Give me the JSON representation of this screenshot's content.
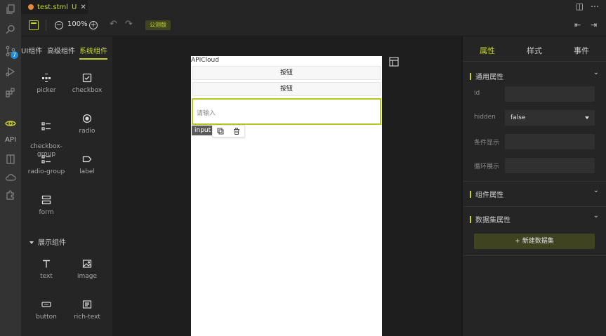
{
  "tab": {
    "filename": "test.stml",
    "status": "U"
  },
  "toolbar": {
    "zoom": "100%",
    "badge": "公测版"
  },
  "left_panel": {
    "tabs": [
      "UI组件",
      "高级组件",
      "系统组件"
    ],
    "components": [
      {
        "label": "picker",
        "icon": "picker-icon"
      },
      {
        "label": "checkbox",
        "icon": "checkbox-icon"
      },
      {
        "label": "checkbox-\ngroup",
        "icon": "list-icon"
      },
      {
        "label": "radio",
        "icon": "radio-icon"
      },
      {
        "label": "radio-group",
        "icon": "list-icon"
      },
      {
        "label": "label",
        "icon": "label-icon"
      },
      {
        "label": "form",
        "icon": "form-icon"
      }
    ],
    "section": "展示组件",
    "display_components": [
      {
        "label": "text",
        "icon": "text-icon"
      },
      {
        "label": "image",
        "icon": "image-icon"
      },
      {
        "label": "button",
        "icon": "button-icon"
      },
      {
        "label": "rich-text",
        "icon": "rich-text-icon"
      }
    ]
  },
  "activity": {
    "badge_count": "7",
    "api_label": "API"
  },
  "canvas": {
    "app_title": "APICloud",
    "button1": "按钮",
    "button2": "按钮",
    "input_placeholder": "请输入",
    "selected_tag": "input"
  },
  "right_panel": {
    "tabs": [
      "属性",
      "样式",
      "事件"
    ],
    "general_section": "通用属性",
    "fields": [
      {
        "label": "id",
        "value": ""
      },
      {
        "label": "hidden",
        "value": "false"
      },
      {
        "label": "条件显示",
        "value": ""
      },
      {
        "label": "循环展示",
        "value": ""
      }
    ],
    "component_section": "组件属性",
    "dataset_section": "数据集属性",
    "new_dataset_button": "+ 新建数据集"
  },
  "colors": {
    "accent": "#c5d42a",
    "background": "#1e1e1e",
    "panel": "#252526"
  }
}
